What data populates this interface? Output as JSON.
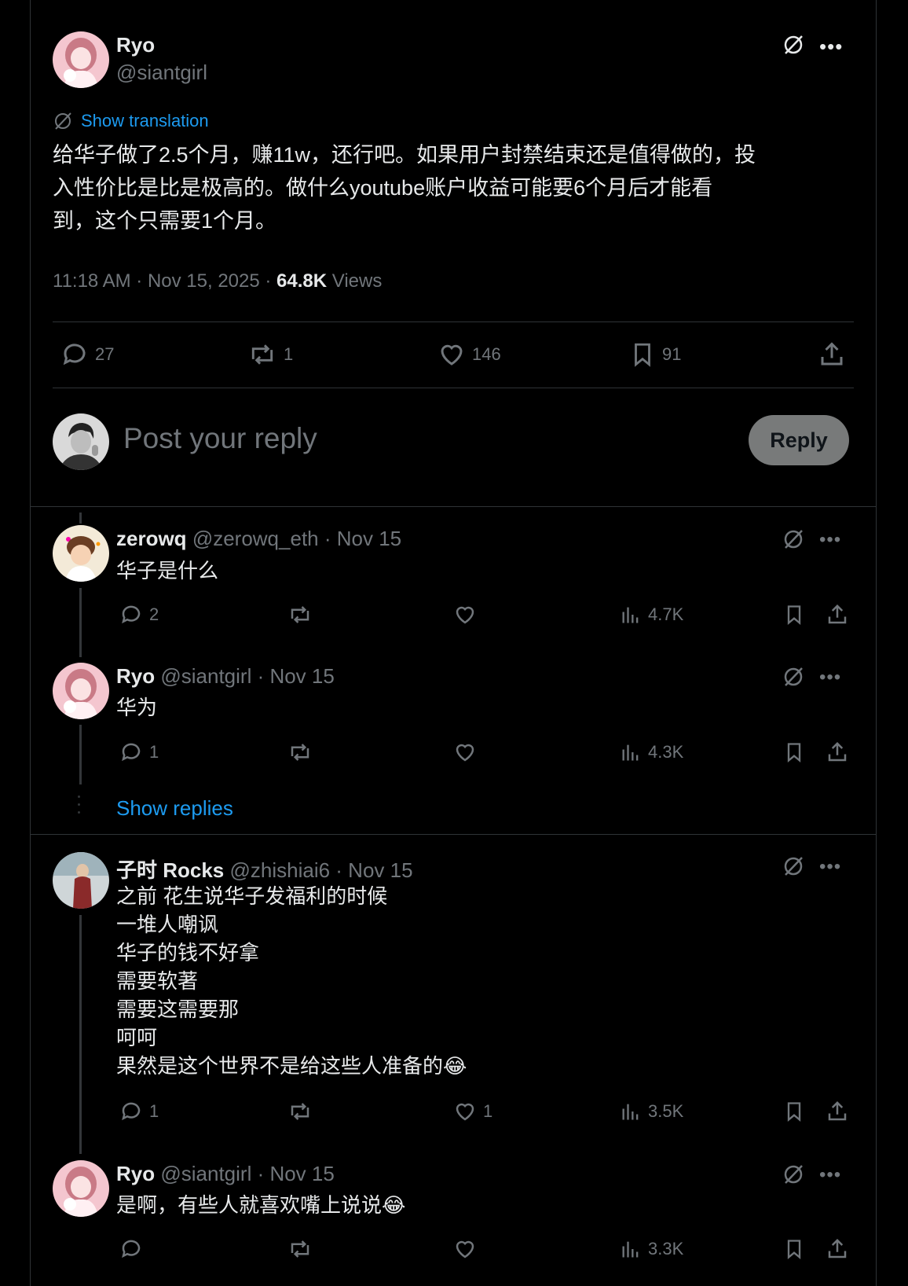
{
  "main_post": {
    "display_name": "Ryo",
    "handle": "@siantgirl",
    "translate_label": "Show translation",
    "text_lines": [
      "给华子做了2.5个月，赚11w，还行吧。如果用户封禁结束还是值得做的，投",
      "入性价比是比是极高的。做什么youtube账户收益可能要6个月后才能看",
      "到，这个只需要1个月。"
    ],
    "timestamp": "11:18 AM · Nov 15, 2025 · ",
    "views_count": "64.8K",
    "views_label": " Views",
    "stats": {
      "replies": "27",
      "reposts": "1",
      "likes": "146",
      "bookmarks": "91"
    }
  },
  "composer": {
    "placeholder": "Post your reply",
    "reply_button": "Reply"
  },
  "replies": [
    {
      "display_name": "zerowq",
      "handle": "@zerowq_eth",
      "date": " · Nov 15",
      "text_lines": [
        "华子是什么"
      ],
      "replies": "2",
      "reposts": "",
      "likes": "",
      "views": "4.7K"
    },
    {
      "display_name": "Ryo",
      "handle": "@siantgirl",
      "date": " · Nov 15",
      "text_lines": [
        "华为"
      ],
      "replies": "1",
      "reposts": "",
      "likes": "",
      "views": "4.3K"
    },
    {
      "display_name": "子时 Rocks",
      "handle": "@zhishiai6",
      "date": " · Nov 15",
      "text_lines": [
        "之前 花生说华子发福利的时候",
        "一堆人嘲讽",
        "华子的钱不好拿",
        "需要软著",
        "需要这需要那",
        "呵呵",
        "果然是这个世界不是给这些人准备的😂"
      ],
      "replies": "1",
      "reposts": "",
      "likes": "1",
      "views": "3.5K"
    },
    {
      "display_name": "Ryo",
      "handle": "@siantgirl",
      "date": " · Nov 15",
      "text_lines": [
        "是啊，有些人就喜欢嘴上说说😂"
      ],
      "replies": "",
      "reposts": "",
      "likes": "",
      "views": "3.3K"
    }
  ],
  "show_replies": "Show replies",
  "colors": {
    "accent": "#1d9bf0",
    "muted": "#71767b",
    "divider": "#2f3336",
    "reply_button_bg": "#787a7a"
  }
}
